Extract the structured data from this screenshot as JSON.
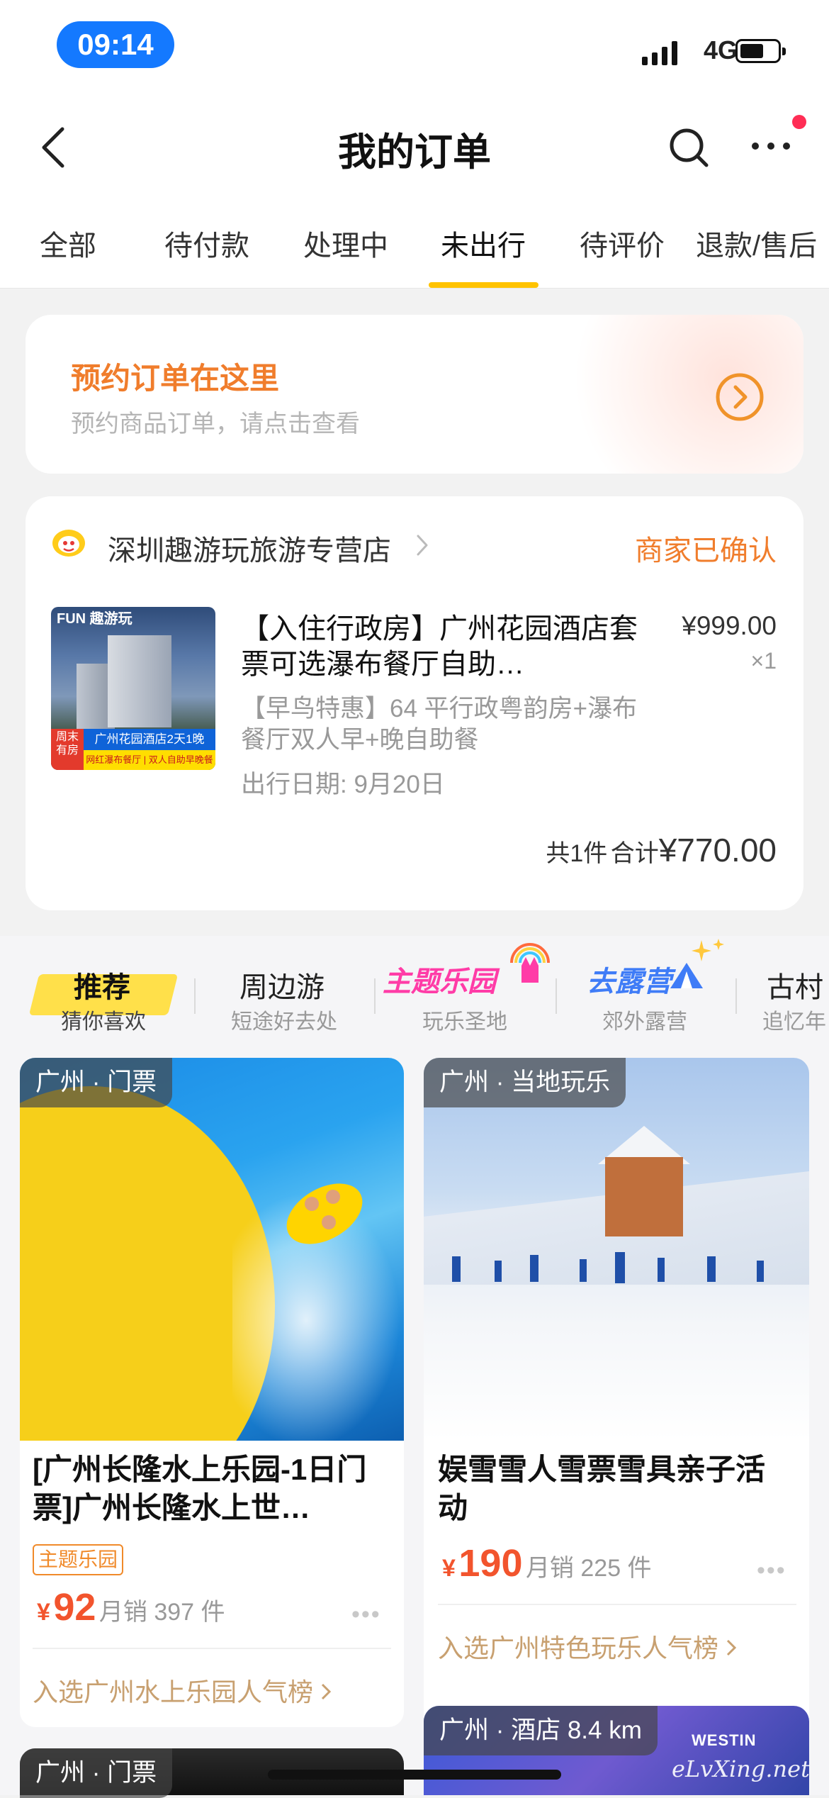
{
  "status_bar": {
    "time": "09:14",
    "network": "4G"
  },
  "nav": {
    "title": "我的订单"
  },
  "tabs": [
    {
      "label": "全部"
    },
    {
      "label": "待付款"
    },
    {
      "label": "处理中"
    },
    {
      "label": "未出行",
      "active": true
    },
    {
      "label": "待评价"
    },
    {
      "label": "退款/售后"
    }
  ],
  "reservation": {
    "title": "预约订单在这里",
    "subtitle": "预约商品订单，请点击查看"
  },
  "order": {
    "shop_name": "深圳趣游玩旅游专营店",
    "status": "商家已确认",
    "thumb": {
      "brand": "FUN 趣游玩",
      "tag_red": "周末有房",
      "tag_blue": "广州花园酒店2天1晚",
      "tag_yellow": "网红瀑布餐厅 | 双人自助早晚餐"
    },
    "product_title": "【入住行政房】广州花园酒店套票可选瀑布餐厅自助…",
    "price": "¥999.00",
    "qty": "×1",
    "spec": "【早鸟特惠】64 平行政粤韵房+瀑布餐厅双人早+晚自助餐",
    "date": "出行日期: 9月20日",
    "count_text": "共1件",
    "total_label": "合计",
    "total": "¥770.00"
  },
  "rec_tabs": [
    {
      "title": "推荐",
      "sub": "猜你喜欢",
      "active": true
    },
    {
      "title": "周边游",
      "sub": "短途好去处"
    },
    {
      "title": "主题乐园",
      "sub": "玩乐圣地",
      "logo": true
    },
    {
      "title": "去露营",
      "sub": "郊外露营",
      "logo": true
    },
    {
      "title": "古村",
      "sub": "追忆年"
    }
  ],
  "products": [
    {
      "location": "广州 · 门票",
      "title": "[广州长隆水上乐园-1日门票]广州长隆水上世…",
      "badge": "主题乐园",
      "currency": "¥",
      "price": "92",
      "sales": "月销 397 件",
      "rank": "入选广州水上乐园人气榜"
    },
    {
      "location": "广州 · 当地玩乐",
      "title": "娱雪雪人雪票雪具亲子活动",
      "currency": "¥",
      "price": "190",
      "sales": "月销 225 件",
      "rank": "入选广州特色玩乐人气榜"
    },
    {
      "location": "广州 · 门票"
    },
    {
      "location": "广州 · 酒店 8.4 km",
      "sign": "WESTIN"
    }
  ],
  "more_dots": "•••",
  "watermark": "eLvXing.net",
  "colors": {
    "accent_yellow": "#ffc300",
    "orange": "#f07d2c",
    "price_red": "#f2542d",
    "blue_pill": "#1479ff"
  }
}
